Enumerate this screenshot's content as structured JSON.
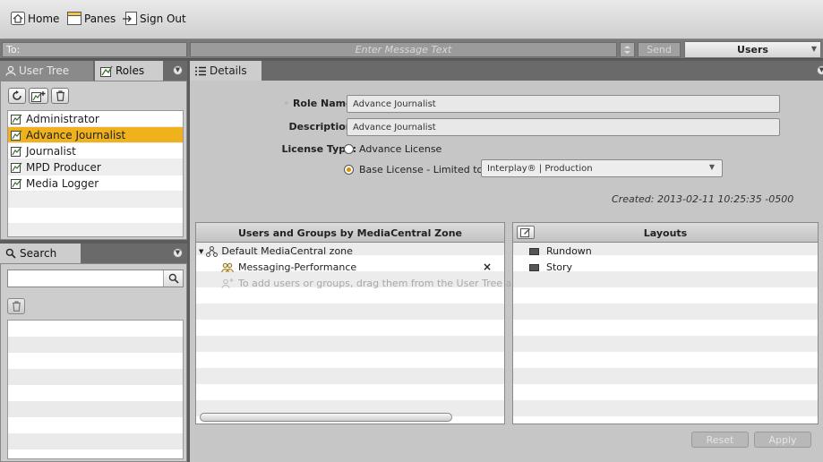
{
  "toolbar": {
    "home_label": "Home",
    "panes_label": "Panes",
    "signout_label": "Sign Out"
  },
  "messagebar": {
    "to_label": "To:",
    "message_placeholder": "Enter Message Text",
    "send_label": "Send",
    "users_label": "Users"
  },
  "left_tabs": {
    "user_tree": "User Tree",
    "roles": "Roles"
  },
  "roles": {
    "items": [
      "Administrator",
      "Advance Journalist",
      "Journalist",
      "MPD Producer",
      "Media Logger"
    ],
    "selected": "Advance Journalist"
  },
  "search": {
    "tab_label": "Search",
    "query": ""
  },
  "details": {
    "tab_label": "Details",
    "role_name_label": "Role Name:",
    "role_name_value": "Advance Journalist",
    "description_label": "Description:",
    "description_value": "Advance Journalist",
    "license_type_label": "License Type:",
    "license_advance": "Advance License",
    "license_base": "Base License - Limited to:",
    "license_selected": "base",
    "limited_to_value": "Interplay® | Production",
    "created": "Created:  2013-02-11 10:25:35 -0500"
  },
  "users_groups": {
    "header": "Users and Groups by MediaCentral Zone",
    "zone": "Default MediaCentral zone",
    "group": "Messaging-Performance",
    "remove": "×",
    "hint": "To add users or groups, drag them from the User Tree and d"
  },
  "layouts": {
    "header": "Layouts",
    "items": [
      "Rundown",
      "Story"
    ]
  },
  "buttons": {
    "reset": "Reset",
    "apply": "Apply"
  },
  "colors": {
    "selection": "#f0b21c",
    "radio_on": "#e08a00",
    "background": "#5c5c5c"
  }
}
